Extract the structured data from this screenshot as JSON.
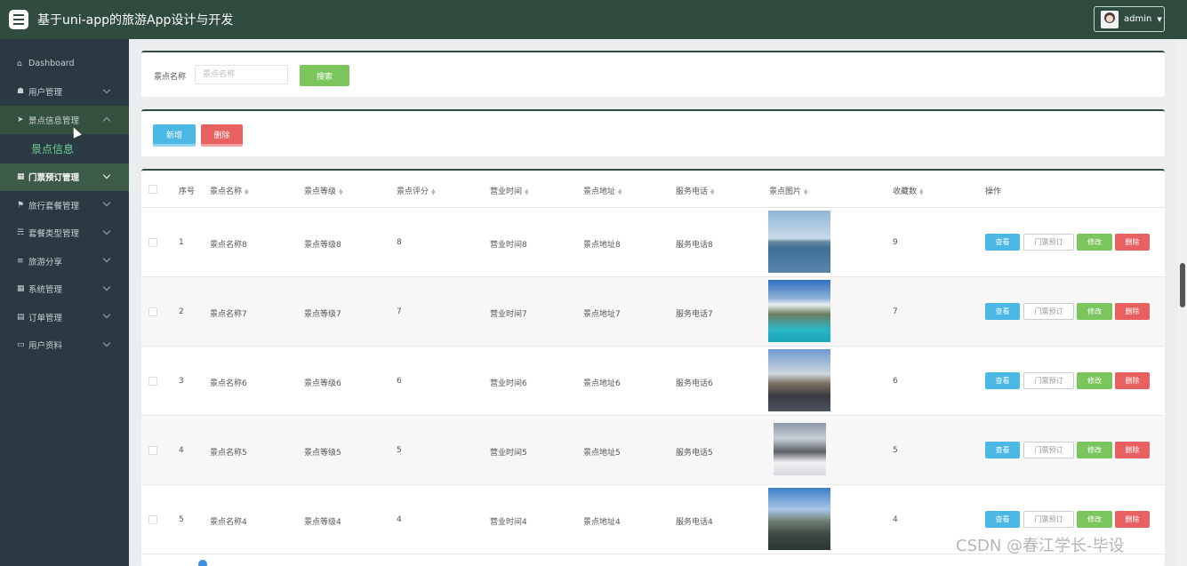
{
  "app": {
    "title": "基于uni-app的旅游App设计与开发",
    "user": "admin"
  },
  "sidebar": {
    "items": [
      {
        "label": "Dashboard",
        "icon": "home-icon"
      },
      {
        "label": "用户管理",
        "icon": "user-group-icon"
      },
      {
        "label": "景点信息管理",
        "icon": "paper-plane-icon",
        "expanded": true
      },
      {
        "label": "门票预订管理",
        "icon": "grid-icon",
        "hovered": true
      },
      {
        "label": "旅行套餐管理",
        "icon": "flag-icon"
      },
      {
        "label": "套餐类型管理",
        "icon": "tag-icon"
      },
      {
        "label": "旅游分享",
        "icon": "list-icon"
      },
      {
        "label": "系统管理",
        "icon": "grid-icon"
      },
      {
        "label": "订单管理",
        "icon": "clipboard-icon"
      },
      {
        "label": "用户资料",
        "icon": "id-card-icon"
      }
    ],
    "sub_item": "景点信息"
  },
  "search": {
    "label": "景点名称",
    "placeholder": "景点名称",
    "button": "搜索"
  },
  "actions": {
    "add": "新增",
    "delete": "删除"
  },
  "table": {
    "columns": [
      "序号",
      "景点名称",
      "景点等级",
      "景点评分",
      "营业时间",
      "景点地址",
      "服务电话",
      "景点图片",
      "收藏数",
      "操作"
    ],
    "row_buttons": {
      "view": "查看",
      "book": "门票预订",
      "edit": "修改",
      "delete": "删除"
    },
    "rows": [
      {
        "no": "1",
        "name": "景点名称8",
        "level": "景点等级8",
        "score": "8",
        "hours": "营业时间8",
        "address": "景点地址8",
        "phone": "服务电话8",
        "favorites": "9"
      },
      {
        "no": "2",
        "name": "景点名称7",
        "level": "景点等级7",
        "score": "7",
        "hours": "营业时间7",
        "address": "景点地址7",
        "phone": "服务电话7",
        "favorites": "7"
      },
      {
        "no": "3",
        "name": "景点名称6",
        "level": "景点等级6",
        "score": "6",
        "hours": "营业时间6",
        "address": "景点地址6",
        "phone": "服务电话6",
        "favorites": "6"
      },
      {
        "no": "4",
        "name": "景点名称5",
        "level": "景点等级5",
        "score": "5",
        "hours": "营业时间5",
        "address": "景点地址5",
        "phone": "服务电话5",
        "favorites": "5"
      },
      {
        "no": "5",
        "name": "景点名称4",
        "level": "景点等级4",
        "score": "4",
        "hours": "营业时间4",
        "address": "景点地址4",
        "phone": "服务电话4",
        "favorites": "4"
      }
    ]
  },
  "watermark": "CSDN @春江学长-毕设"
}
